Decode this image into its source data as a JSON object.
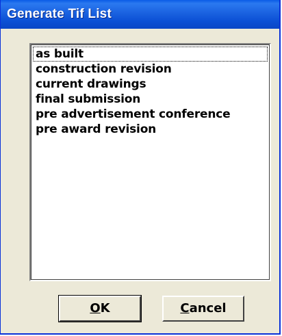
{
  "window": {
    "title": "Generate Tif List"
  },
  "list": {
    "items": [
      "as built",
      "construction revision",
      "current drawings",
      "final submission",
      "pre advertisement conference",
      "pre award revision"
    ]
  },
  "buttons": {
    "ok": {
      "accel": "O",
      "rest": "K"
    },
    "cancel": {
      "accel": "C",
      "rest": "ancel"
    }
  }
}
